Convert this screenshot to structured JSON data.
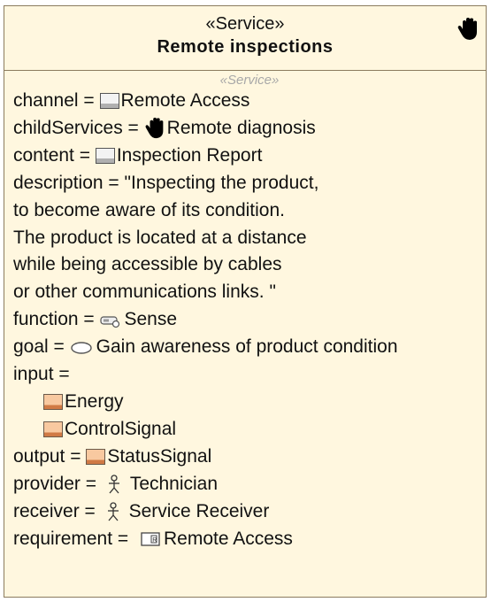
{
  "block": {
    "stereotype": "«Service»",
    "name": "Remote inspections",
    "compartment_title": "«Service»",
    "channel": {
      "label": "channel = ",
      "value": "Remote Access",
      "icon": "block-icon"
    },
    "childServices": {
      "label": "childServices = ",
      "value": "Remote diagnosis",
      "icon": "hand-icon"
    },
    "content": {
      "label": "content = ",
      "value": "Inspection Report",
      "icon": "block-icon"
    },
    "description": [
      "description = \"Inspecting the product,",
      "to become aware of its condition.",
      "The product is located at a distance",
      "while being accessible by cables",
      "or other communications links. \""
    ],
    "function": {
      "label": "function = ",
      "value": "Sense",
      "icon": "function-icon"
    },
    "goal": {
      "label": "goal = ",
      "value": "Gain awareness of product condition",
      "icon": "goal-icon"
    },
    "input": {
      "label": "input =",
      "items": [
        "Energy",
        "ControlSignal"
      ],
      "icon": "flow-block-icon"
    },
    "output": {
      "label": "output = ",
      "value": "StatusSignal",
      "icon": "flow-block-icon"
    },
    "provider": {
      "label": "provider = ",
      "value": "Technician",
      "icon": "actor-icon"
    },
    "receiver": {
      "label": "receiver = ",
      "value": "Service Receiver",
      "icon": "actor-icon"
    },
    "requirement": {
      "label": "requirement = ",
      "value": "Remote Access",
      "icon": "requirement-icon"
    }
  },
  "colors": {
    "fill": "#fff7df",
    "border": "#8c7c5e",
    "stereotype_grey": "#a8a8a8"
  }
}
